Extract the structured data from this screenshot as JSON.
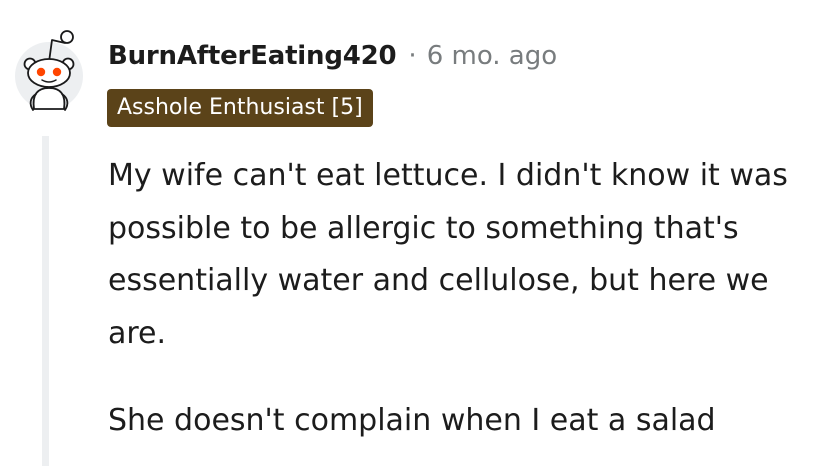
{
  "comment": {
    "username": "BurnAfterEating420",
    "separator": "·",
    "timestamp": "6 mo. ago",
    "flair": "Asshole Enthusiast [5]",
    "paragraphs": [
      "My wife can't eat lettuce. I didn't know it was possible to be allergic to something that's essentially water and cellulose, but here we are.",
      "She doesn't complain when I eat a salad"
    ]
  },
  "avatar": {
    "icon": "reddit-snoo-avatar-icon"
  },
  "colors": {
    "flair_background": "#5b4319",
    "flair_text": "#ffffff",
    "username": "#1c1c1c",
    "meta_gray": "#787c7e",
    "avatar_background": "#edeff1",
    "snoo_eyes": "#ff4500",
    "thread_line": "#edeff1"
  }
}
